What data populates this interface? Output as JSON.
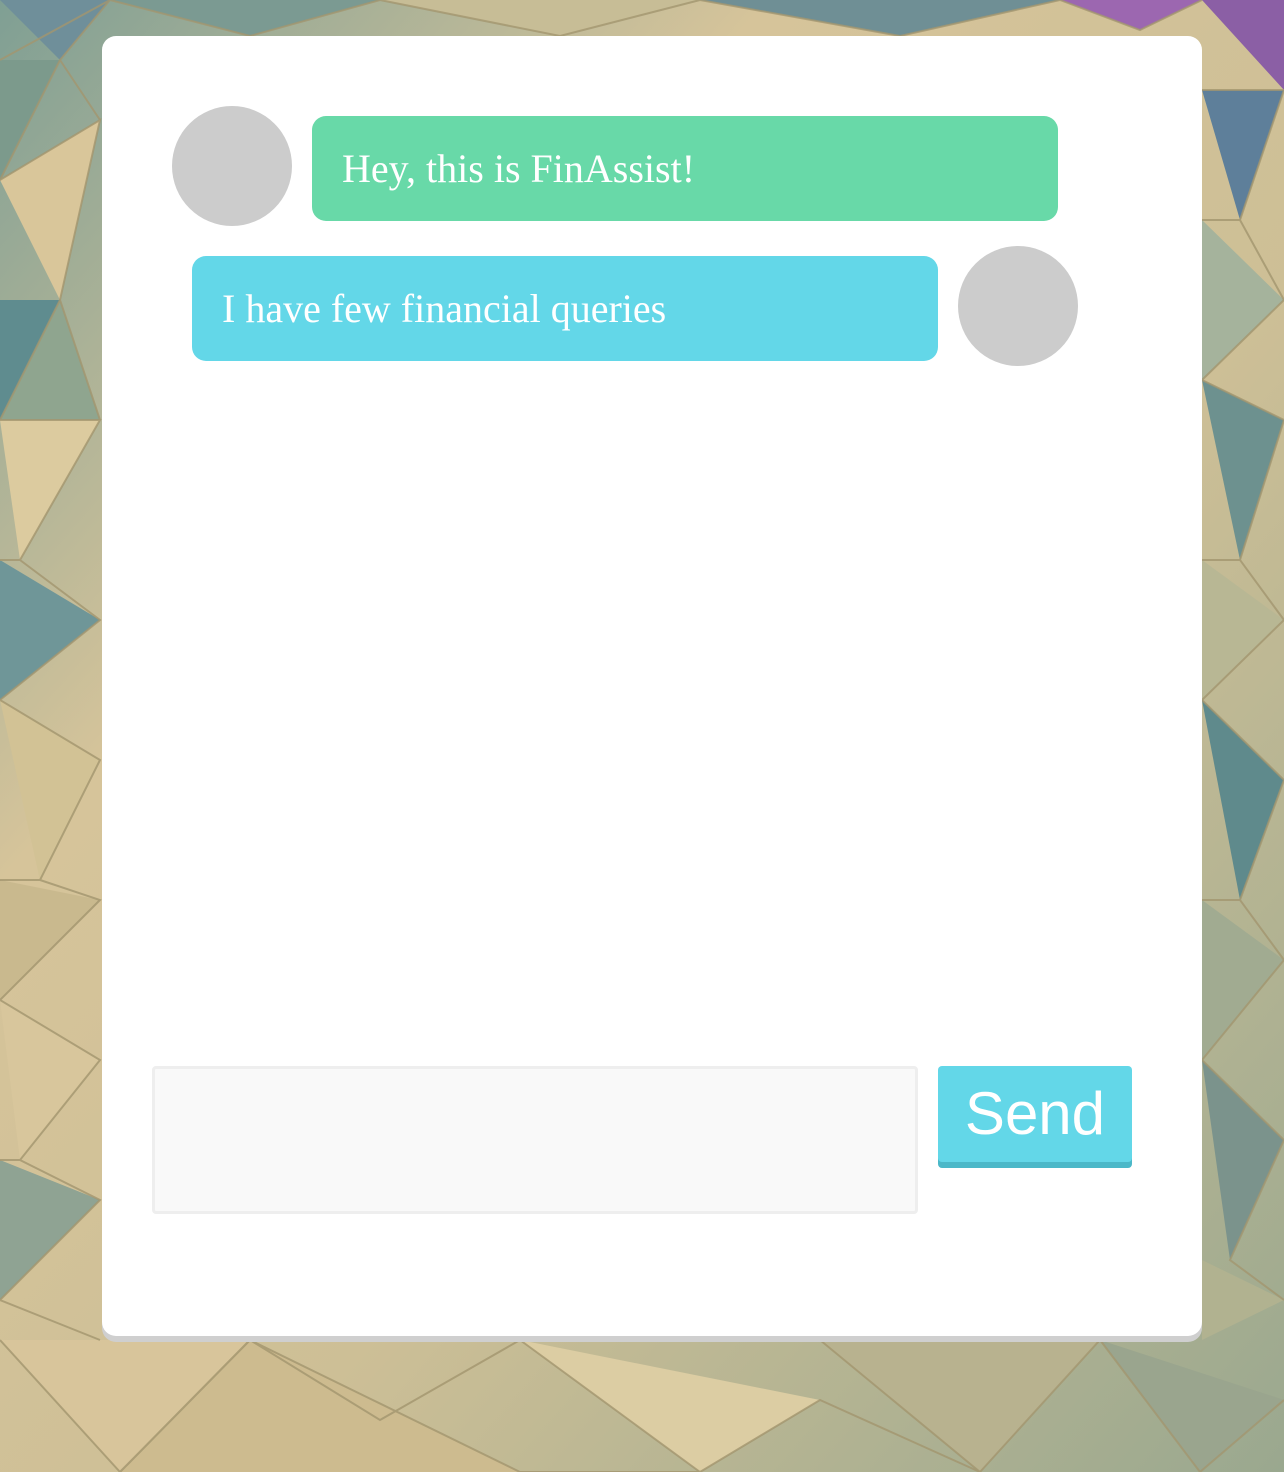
{
  "messages": [
    {
      "sender": "bot",
      "text": "Hey, this is FinAssist!"
    },
    {
      "sender": "user",
      "text": "I have few financial queries"
    }
  ],
  "composer": {
    "placeholder": "",
    "value": "",
    "send_label": "Send"
  },
  "colors": {
    "bot_bubble": "#68d9a8",
    "user_bubble": "#63d7e8",
    "avatar": "#cccccc",
    "send_button": "#63d7e8",
    "card": "#ffffff"
  }
}
